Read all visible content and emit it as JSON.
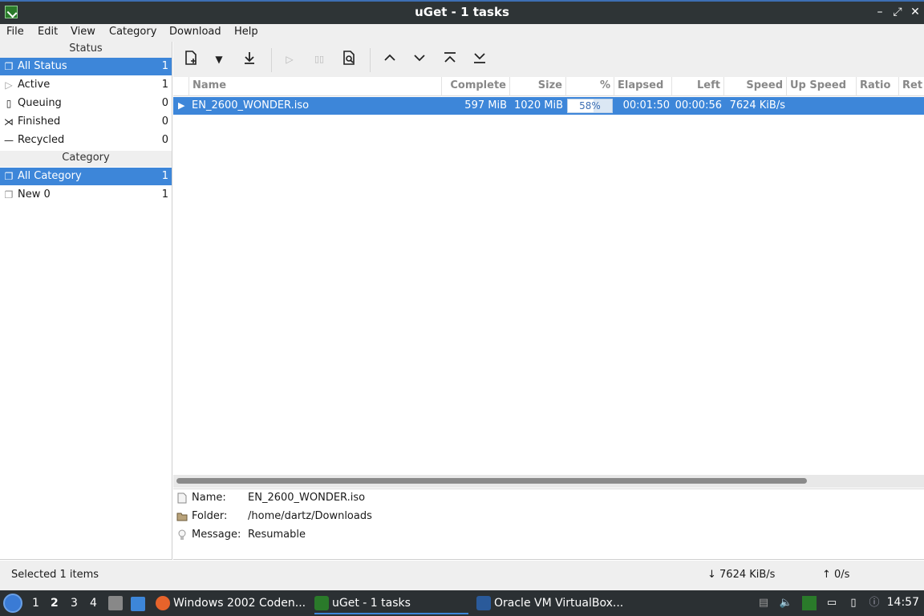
{
  "window": {
    "title": "uGet - 1 tasks",
    "minimize": "–",
    "maximize": "⤢",
    "close": "✕"
  },
  "menu": [
    "File",
    "Edit",
    "View",
    "Category",
    "Download",
    "Help"
  ],
  "status_section": {
    "header": "Status",
    "items": [
      {
        "label": "All Status",
        "count": "1",
        "icon": "stack-icon"
      },
      {
        "label": "Active",
        "count": "1",
        "icon": "play-icon"
      },
      {
        "label": "Queuing",
        "count": "0",
        "icon": "page-icon"
      },
      {
        "label": "Finished",
        "count": "0",
        "icon": "finish-icon"
      },
      {
        "label": "Recycled",
        "count": "0",
        "icon": "dash-icon"
      }
    ]
  },
  "category_section": {
    "header": "Category",
    "items": [
      {
        "label": "All Category",
        "count": "1",
        "icon": "stack-icon"
      },
      {
        "label": "New 0",
        "count": "1",
        "icon": "stack-icon"
      }
    ]
  },
  "toolbar": {
    "icons": [
      "new-download-icon",
      "dropdown-arrow-icon",
      "download-icon",
      "start-icon",
      "pause-icon",
      "properties-icon",
      "move-up-icon",
      "move-down-icon",
      "move-top-icon",
      "move-bottom-icon"
    ]
  },
  "table": {
    "columns": [
      "Name",
      "Complete",
      "Size",
      "%",
      "Elapsed",
      "Left",
      "Speed",
      "Up Speed",
      "Ratio",
      "Ret"
    ],
    "rows": [
      {
        "name": "EN_2600_WONDER.iso",
        "complete": "597 MiB",
        "size": "1020 MiB",
        "percent": "58%",
        "progress": 0.58,
        "elapsed": "00:01:50",
        "left": "00:00:56",
        "speed": "7624 KiB/s",
        "up_speed": "",
        "ratio": ""
      }
    ]
  },
  "details": {
    "name_label": "Name:",
    "name_value": "EN_2600_WONDER.iso",
    "folder_label": "Folder:",
    "folder_value": "/home/dartz/Downloads",
    "message_label": "Message:",
    "message_value": "Resumable"
  },
  "statusbar": {
    "selected": "Selected 1 items",
    "down_speed": "↓  7624 KiB/s",
    "up_speed": "↑  0/s"
  },
  "taskbar": {
    "workspaces": [
      "1",
      "2",
      "3",
      "4"
    ],
    "tasks": [
      "Windows 2002 Coden...",
      "uGet - 1 tasks",
      "Oracle VM VirtualBox..."
    ],
    "clock": "14:57"
  },
  "colors": {
    "selection": "#3d86d9",
    "titlebar": "#2e3436",
    "taskbar": "#2b3033"
  }
}
